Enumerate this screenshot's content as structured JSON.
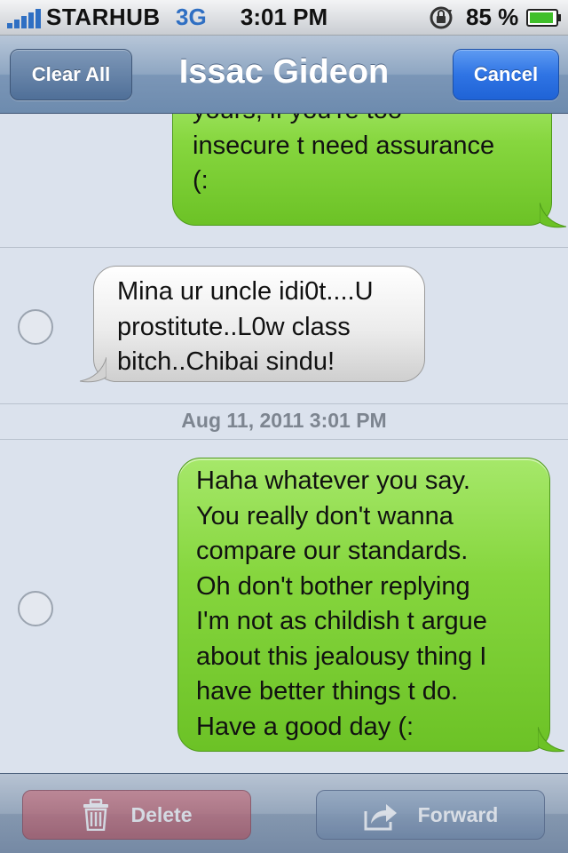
{
  "status_bar": {
    "carrier": "STARHUB",
    "network": "3G",
    "time": "3:01 PM",
    "battery": "85 %",
    "icons": [
      "signal-bars-icon",
      "rotation-lock-icon",
      "battery-icon"
    ],
    "accent_color": "#2f6fc3"
  },
  "nav": {
    "title": "Issac Gideon",
    "left_button": "Clear All",
    "right_button": "Cancel"
  },
  "messages": [
    {
      "direction": "outgoing",
      "color": "#86d63e",
      "lines": [
        "yours, if you're too",
        "insecure t need assurance",
        "(:"
      ]
    },
    {
      "direction": "incoming",
      "color": "#ececec",
      "lines": [
        "Mina ur uncle idi0t....U",
        "prostitute..L0w class",
        "bitch..Chibai sindu!"
      ]
    },
    {
      "direction": "outgoing",
      "color": "#86d63e",
      "lines": [
        "Haha whatever you say.",
        "You really don't wanna",
        "compare our standards.",
        "Oh don't bother replying",
        "I'm not as childish t argue",
        "about this jealousy thing I",
        "have better things t do.",
        "Have a good day (:"
      ]
    }
  ],
  "timestamp": "Aug 11, 2011 3:01 PM",
  "toolbar": {
    "delete_label": "Delete",
    "forward_label": "Forward",
    "delete_icon": "trash-icon",
    "forward_icon": "forward-arrow-icon"
  }
}
